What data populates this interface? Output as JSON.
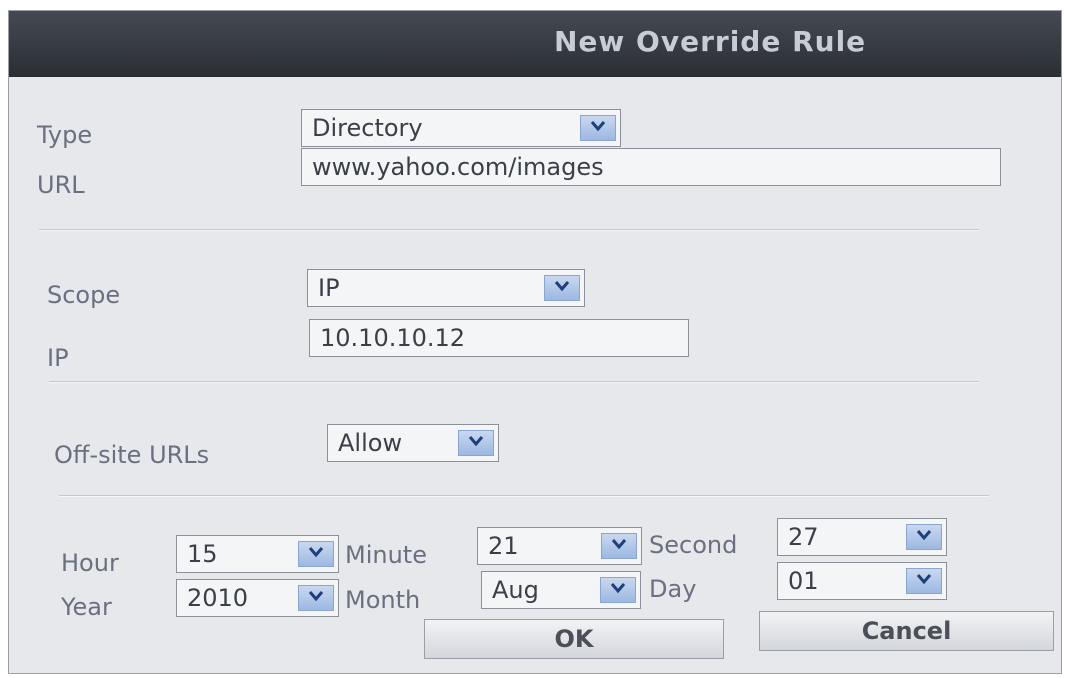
{
  "dialog": {
    "title": "New Override Rule",
    "type": {
      "label": "Type",
      "value": "Directory"
    },
    "url": {
      "label": "URL",
      "value": "www.yahoo.com/images"
    },
    "scope": {
      "label": "Scope",
      "value": "IP"
    },
    "ip": {
      "label": "IP",
      "value": "10.10.10.12"
    },
    "offsite": {
      "label": "Off-site URLs",
      "value": "Allow"
    },
    "time": {
      "hour": {
        "label": "Hour",
        "value": "15"
      },
      "minute": {
        "label": "Minute",
        "value": "21"
      },
      "second": {
        "label": "Second",
        "value": "27"
      },
      "year": {
        "label": "Year",
        "value": "2010"
      },
      "month": {
        "label": "Month",
        "value": "Aug"
      },
      "day": {
        "label": "Day",
        "value": "01"
      }
    },
    "buttons": {
      "ok": "OK",
      "cancel": "Cancel"
    }
  },
  "icons": {
    "dropdown": "chevron-down-icon"
  },
  "colors": {
    "titlebar": "#2f333a",
    "dialog_bg": "#e6e8ec",
    "dropdown_arrow": "#9db8e2"
  }
}
